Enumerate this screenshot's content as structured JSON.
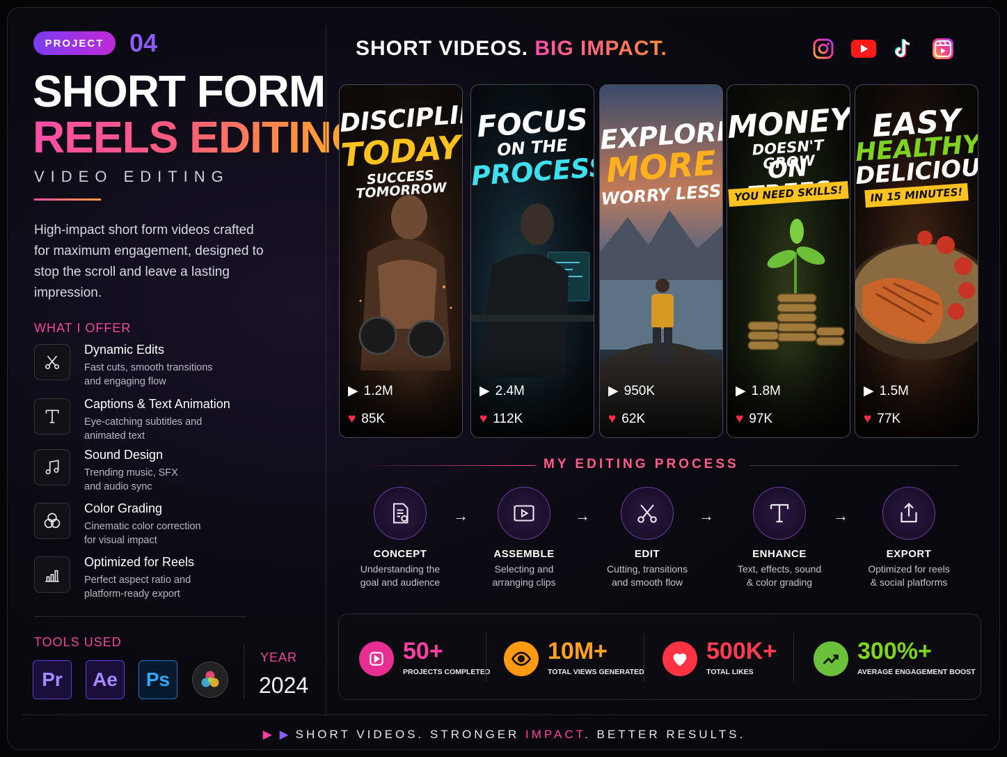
{
  "header": {
    "project_label": "PROJECT",
    "project_number": "04",
    "title_line1": "SHORT FORM",
    "title_line2": "REELS EDITING",
    "subtitle": "VIDEO EDITING",
    "description": "High-impact short form videos crafted for maximum engagement, designed to stop the scroll and leave a lasting impression."
  },
  "offer": {
    "label": "WHAT I OFFER",
    "items": [
      {
        "title": "Dynamic Edits",
        "line1": "Fast cuts, smooth transitions",
        "line2": "and engaging flow",
        "icon": "scissors-icon"
      },
      {
        "title": "Captions & Text Animation",
        "line1": "Eye-catching subtitles and",
        "line2": "animated text",
        "icon": "text-icon"
      },
      {
        "title": "Sound Design",
        "line1": "Trending music, SFX",
        "line2": "and audio sync",
        "icon": "music-note-icon"
      },
      {
        "title": "Color Grading",
        "line1": "Cinematic color correction",
        "line2": "for visual impact",
        "icon": "color-circles-icon"
      },
      {
        "title": "Optimized for Reels",
        "line1": "Perfect aspect ratio and",
        "line2": "platform-ready export",
        "icon": "bar-chart-icon"
      }
    ]
  },
  "tools": {
    "label": "TOOLS USED",
    "items": [
      "Pr",
      "Ae",
      "Ps"
    ],
    "year_label": "YEAR",
    "year": "2024"
  },
  "hero": {
    "headline_white": "SHORT VIDEOS.",
    "headline_accent": "BIG IMPACT."
  },
  "social_icons": [
    "instagram-icon",
    "youtube-icon",
    "tiktok-icon",
    "reels-icon"
  ],
  "reels": [
    {
      "l1": "DISCIPLINE",
      "l2": "TODAY",
      "l3": "SUCCESS TOMORROW",
      "views": "1.2M",
      "likes": "85K"
    },
    {
      "l1": "FOCUS",
      "l2": "ON THE",
      "l3": "PROCESS",
      "views": "2.4M",
      "likes": "112K"
    },
    {
      "l1": "EXPLORE",
      "l2": "MORE",
      "l3": "WORRY LESS",
      "views": "950K",
      "likes": "62K"
    },
    {
      "l1": "MONEY",
      "l2": "DOESN'T GROW",
      "l3": "ON TREES",
      "l4": "YOU NEED SKILLS!",
      "views": "1.8M",
      "likes": "97K"
    },
    {
      "l1": "EASY",
      "l2": "HEALTHY",
      "l3": "DELICIOUS",
      "l4": "IN 15 MINUTES!",
      "views": "1.5M",
      "likes": "77K"
    }
  ],
  "process": {
    "title": "MY EDITING PROCESS",
    "steps": [
      {
        "name": "CONCEPT",
        "l1": "Understanding the",
        "l2": "goal and audience"
      },
      {
        "name": "ASSEMBLE",
        "l1": "Selecting and",
        "l2": "arranging clips"
      },
      {
        "name": "EDIT",
        "l1": "Cutting, transitions",
        "l2": "and smooth flow"
      },
      {
        "name": "ENHANCE",
        "l1": "Text, effects, sound",
        "l2": "& color grading"
      },
      {
        "name": "EXPORT",
        "l1": "Optimized for reels",
        "l2": "& social platforms"
      }
    ]
  },
  "kpis": [
    {
      "value": "50+",
      "label": "PROJECTS COMPLETED",
      "color": "#ff3fa4"
    },
    {
      "value": "10M+",
      "label": "TOTAL VIEWS GENERATED",
      "color": "#ffa21f"
    },
    {
      "value": "500K+",
      "label": "TOTAL LIKES",
      "color": "#ff3b4e"
    },
    {
      "value": "300%+",
      "label": "AVERAGE ENGAGEMENT BOOST",
      "color": "#7ed321"
    }
  ],
  "footer": {
    "part1": "SHORT VIDEOS. STRONGER ",
    "accent": "IMPACT",
    "part2": ". BETTER RESULTS."
  }
}
